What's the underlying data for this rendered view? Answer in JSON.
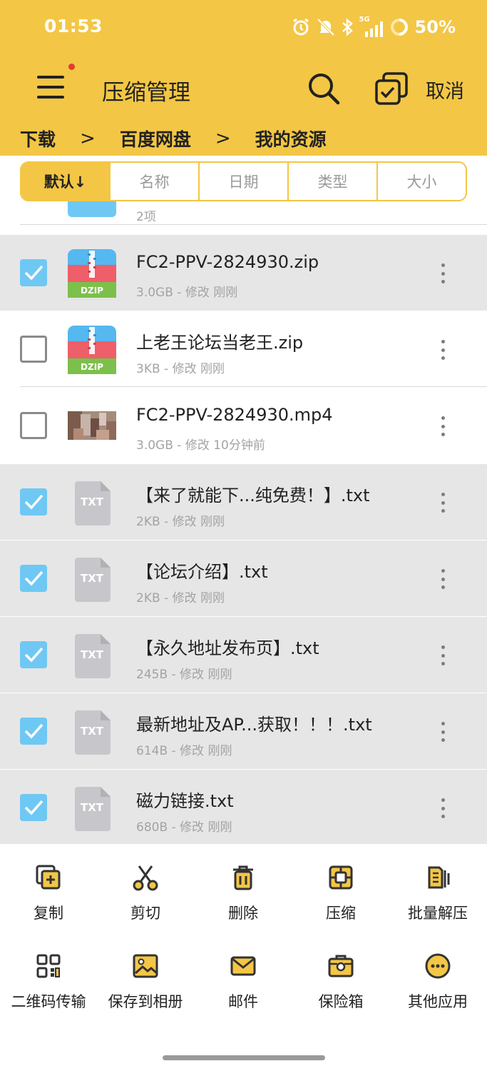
{
  "status": {
    "time": "01:53",
    "network": "5G",
    "battery": "50%"
  },
  "toolbar": {
    "title": "压缩管理",
    "cancel": "取消"
  },
  "breadcrumb": [
    "下载",
    "百度网盘",
    "我的资源"
  ],
  "sort": [
    "默认↓",
    "名称",
    "日期",
    "类型",
    "大小"
  ],
  "partial_row": {
    "meta": "2项"
  },
  "files": [
    {
      "name": "FC2-PPV-2824930.zip",
      "meta": "3.0GB - 修改 刚刚",
      "icon": "zip-icon",
      "badge": "DZIP",
      "checked": true
    },
    {
      "name": "上老王论坛当老王.zip",
      "meta": "3KB - 修改 刚刚",
      "icon": "zip-icon",
      "badge": "DZIP",
      "checked": false
    },
    {
      "name": "FC2-PPV-2824930.mp4",
      "meta": "3.0GB - 修改 10分钟前",
      "icon": "video-thumbnail",
      "checked": false
    },
    {
      "name": "【来了就能下...纯免费！】.txt",
      "meta": "2KB - 修改 刚刚",
      "icon": "txt-icon",
      "badge": "TXT",
      "checked": true
    },
    {
      "name": "【论坛介绍】.txt",
      "meta": "2KB - 修改 刚刚",
      "icon": "txt-icon",
      "badge": "TXT",
      "checked": true
    },
    {
      "name": "【永久地址发布页】.txt",
      "meta": "245B - 修改 刚刚",
      "icon": "txt-icon",
      "badge": "TXT",
      "checked": true
    },
    {
      "name": "最新地址及AP...获取！！！.txt",
      "meta": "614B - 修改 刚刚",
      "icon": "txt-icon",
      "badge": "TXT",
      "checked": true
    },
    {
      "name": "磁力链接.txt",
      "meta": "680B - 修改 刚刚",
      "icon": "txt-icon",
      "badge": "TXT",
      "checked": true
    }
  ],
  "actions": [
    {
      "label": "复制",
      "icon": "copy-icon"
    },
    {
      "label": "剪切",
      "icon": "scissors-icon"
    },
    {
      "label": "删除",
      "icon": "trash-icon"
    },
    {
      "label": "压缩",
      "icon": "compress-icon"
    },
    {
      "label": "批量解压",
      "icon": "batch-extract-icon"
    },
    {
      "label": "二维码传输",
      "icon": "qr-code-icon"
    },
    {
      "label": "保存到相册",
      "icon": "image-icon"
    },
    {
      "label": "邮件",
      "icon": "mail-icon"
    },
    {
      "label": "保险箱",
      "icon": "safe-box-icon"
    },
    {
      "label": "其他应用",
      "icon": "more-apps-icon"
    }
  ],
  "colors": {
    "header": "#f3c645",
    "checkbox": "#6fc8f4",
    "selected_row": "#e6e6e6",
    "icon_accent": "#f3c645"
  }
}
